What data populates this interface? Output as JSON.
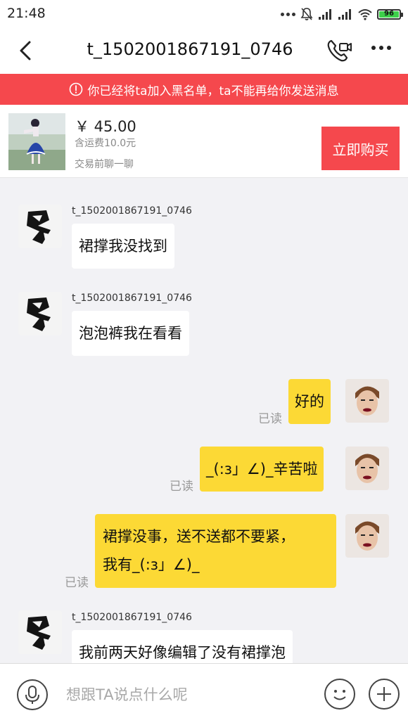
{
  "status_bar": {
    "time": "21:48",
    "battery_level": "96",
    "icons": [
      "more-dots-icon",
      "mute-bell-icon",
      "signal-icon",
      "signal-icon",
      "wifi-icon",
      "battery-icon"
    ],
    "battery_color": "#3dd04a"
  },
  "nav": {
    "title": "t_1502001867191_0746",
    "back_icon": "back-chevron-icon",
    "call_icon": "video-call-icon",
    "more_icon": "more-dots-icon"
  },
  "banner": {
    "text": "你已经将ta加入黑名单，ta不能再给你发送消息",
    "icon": "warning-icon",
    "color": "#f5484d"
  },
  "product": {
    "price": "￥ 45.00",
    "shipping": "含运费10.0元",
    "chat_hint": "交易前聊一聊",
    "buy_label": "立即购买"
  },
  "messages": [
    {
      "direction": "in",
      "sender": "t_1502001867191_0746",
      "lines": [
        "裙撑我没找到"
      ]
    },
    {
      "direction": "in",
      "sender": "t_1502001867191_0746",
      "lines": [
        "泡泡裤我在看看"
      ]
    },
    {
      "direction": "out",
      "status": "已读",
      "lines": [
        "好的"
      ]
    },
    {
      "direction": "out",
      "status": "已读",
      "lines": [
        "_(:з」∠)_辛苦啦"
      ]
    },
    {
      "direction": "out",
      "status": "已读",
      "lines": [
        "裙撑没事，送不送都不要紧，",
        "我有_(:з」∠)_"
      ]
    },
    {
      "direction": "in",
      "sender": "t_1502001867191_0746",
      "lines": [
        "我前两天好像编辑了没有裙撑泡"
      ]
    }
  ],
  "input": {
    "placeholder": "想跟TA说点什么呢",
    "mic_icon": "microphone-icon",
    "emoji_icon": "emoji-icon",
    "plus_icon": "plus-icon"
  },
  "colors": {
    "accent_red": "#f5484d",
    "outgoing_bubble": "#fcd935",
    "background": "#f2f2f5"
  }
}
